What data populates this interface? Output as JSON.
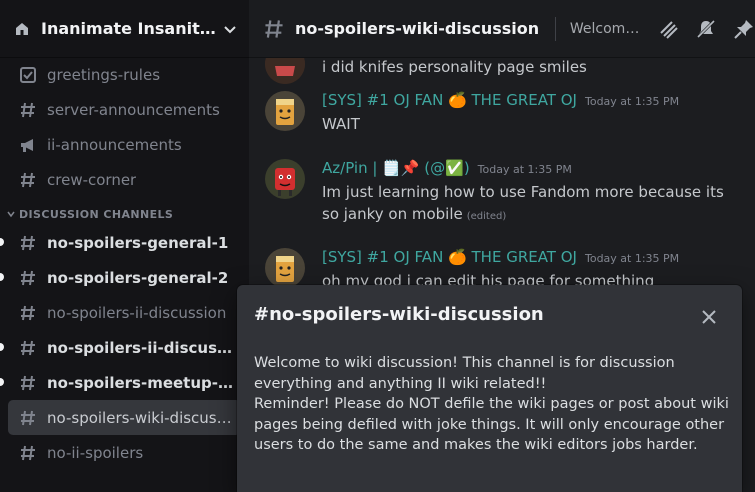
{
  "server": {
    "name": "Inanimate Insanity Di..."
  },
  "sidebar": {
    "channels_top": [
      {
        "label": "greetings-rules",
        "icon": "rules-icon"
      },
      {
        "label": "server-announcements",
        "icon": "hash-icon"
      },
      {
        "label": "ii-announcements",
        "icon": "megaphone-icon"
      },
      {
        "label": "crew-corner",
        "icon": "hash-icon"
      }
    ],
    "category": "DISCUSSION CHANNELS",
    "channels": [
      {
        "label": "no-spoilers-general-1",
        "unread": true
      },
      {
        "label": "no-spoilers-general-2",
        "unread": true
      },
      {
        "label": "no-spoilers-ii-discussion",
        "unread": false
      },
      {
        "label": "no-spoilers-ii-discussion...",
        "unread": true
      },
      {
        "label": "no-spoilers-meetup-dis...",
        "unread": true
      },
      {
        "label": "no-spoilers-wiki-discuss...",
        "unread": false,
        "selected": true
      },
      {
        "label": "no-ii-spoilers",
        "unread": false
      }
    ]
  },
  "topbar": {
    "channel": "no-spoilers-wiki-discussion",
    "topic": "Welcome to wi..."
  },
  "messages": [
    {
      "type": "continuation",
      "text": "i did knifes personality page smiles"
    },
    {
      "author": "[SYS] #1 OJ FAN 🍊 THE GREAT OJ",
      "timestamp": "Today at 1:35 PM",
      "text": "WAIT"
    },
    {
      "author": "Az/Pin | 🗒️📌 (@✅)",
      "timestamp": "Today at 1:35 PM",
      "text": "Im just learning how to use Fandom more because its so janky on mobile",
      "edited": "(edited)"
    },
    {
      "author": "[SYS] #1 OJ FAN 🍊 THE GREAT OJ",
      "timestamp": "Today at 1:35 PM",
      "text": "oh my god i can edit his page for something"
    }
  ],
  "modal": {
    "title": "#no-spoilers-wiki-discussion",
    "body_line1": "Welcome to wiki discussion! This channel is for discussion everything and anything II wiki related!!",
    "body_line2": "Reminder! Please do NOT defile the wiki pages or post about wiki pages being defiled with joke things. It will only encourage other users to do the same and makes the wiki editors jobs harder."
  },
  "colors": {
    "accent_author": "#3fa7a0",
    "sidebar_bg": "#141417",
    "modal_bg": "#313338"
  }
}
